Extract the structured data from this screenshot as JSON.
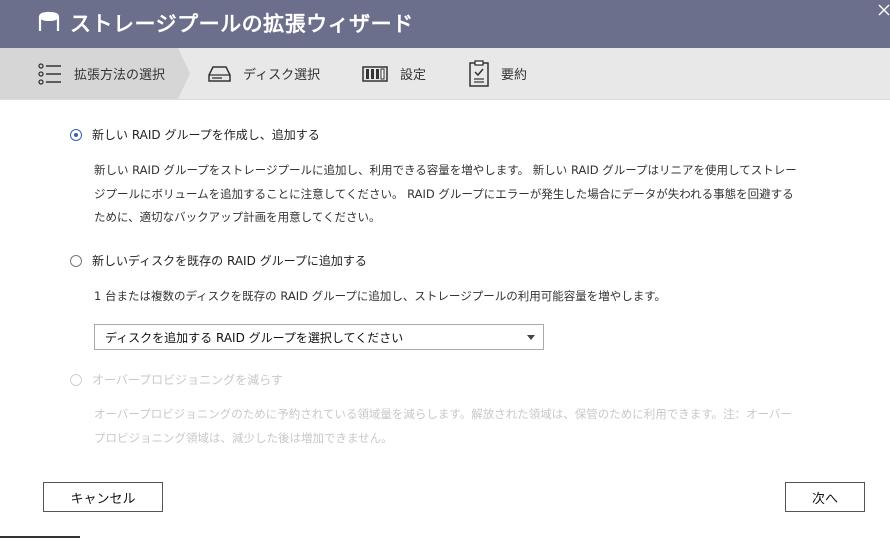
{
  "title": "ストレージプールの拡張ウィザード",
  "steps": [
    {
      "label": "拡張方法の選択",
      "icon": "list-icon",
      "active": true
    },
    {
      "label": "ディスク選択",
      "icon": "disk-drive-icon",
      "active": false
    },
    {
      "label": "設定",
      "icon": "settings-panel-icon",
      "active": false
    },
    {
      "label": "要約",
      "icon": "clipboard-check-icon",
      "active": false
    }
  ],
  "options": [
    {
      "label": "新しい RAID グループを作成し、追加する",
      "checked": true,
      "disabled": false,
      "description_lines": [
        "新しい RAID グループをストレージプールに追加し、利用できる容量を増やします。 新しい RAID グループはリニアを使用してストレー",
        "ジプールにボリュームを追加することに注意してください。 RAID グループにエラーが発生した場合にデータが失われる事態を回避する",
        "ために、適切なバックアップ計画を用意してください。"
      ]
    },
    {
      "label": "新しいディスクを既存の RAID グループに追加する",
      "checked": false,
      "disabled": false,
      "description_lines": [
        "1 台または複数のディスクを既存の RAID グループに追加し、ストレージプールの利用可能容量を増やします。"
      ]
    },
    {
      "label": "オーバープロビジョニングを減らす",
      "checked": false,
      "disabled": true,
      "description_lines": [
        "オーバープロビジョニングのために予約されている領域量を減らします。解放された領域は、保管のために利用できます。注：オーバー",
        "プロビジョニング領域は、減少した後は増加できません。"
      ]
    }
  ],
  "raid_select": {
    "value": "ディスクを追加する RAID グループを選択してください"
  },
  "buttons": {
    "cancel": "キャンセル",
    "next": "次へ"
  },
  "colors": {
    "titlebar": "#6c6f8c",
    "stepbar": "#e8e8e8",
    "active_step": "#d6d6d6",
    "radio_accent": "#3a5fb8",
    "disabled_text": "#c8c8c8"
  }
}
